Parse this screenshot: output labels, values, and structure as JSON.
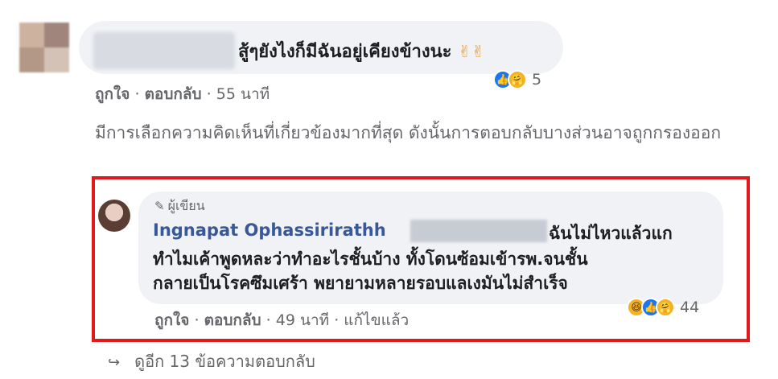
{
  "comment1": {
    "text": "สู้ๆยังไงก็มีฉันอยู่เคียงข้างนะ",
    "emoji": "✌✌",
    "reaction_count": "5",
    "actions": {
      "like": "ถูกใจ",
      "reply": "ตอบกลับ",
      "time": "55 นาที"
    }
  },
  "filter_notice": "มีการเลือกความคิดเห็นที่เกี่ยวข้องมากที่สุด ดังนั้นการตอบกลับบางส่วนอาจถูกกรองออก",
  "reply": {
    "badge": "ผู้เขียน",
    "author": "Ingnapat Ophassirirathh",
    "line1": "ฉันไม่ไหวแล้วแก",
    "line2": "ทำไมเค้าพูดหละว่าทำอะไรชั้นบ้าง ทั้งโดนซ้อมเข้ารพ.จนชั้น",
    "line3": "กลายเป็นโรคซึมเศร้า พยายามหลายรอบแลเงมันไม่สำเร็จ",
    "reaction_count": "44",
    "actions": {
      "like": "ถูกใจ",
      "reply": "ตอบกลับ",
      "time": "49 นาที",
      "edited": "แก้ไขแล้ว"
    }
  },
  "more_replies": "ดูอีก 13 ข้อความตอบกลับ",
  "colors": {
    "highlight": "#e1191a",
    "link": "#385898",
    "bubble": "#f0f2f5"
  }
}
